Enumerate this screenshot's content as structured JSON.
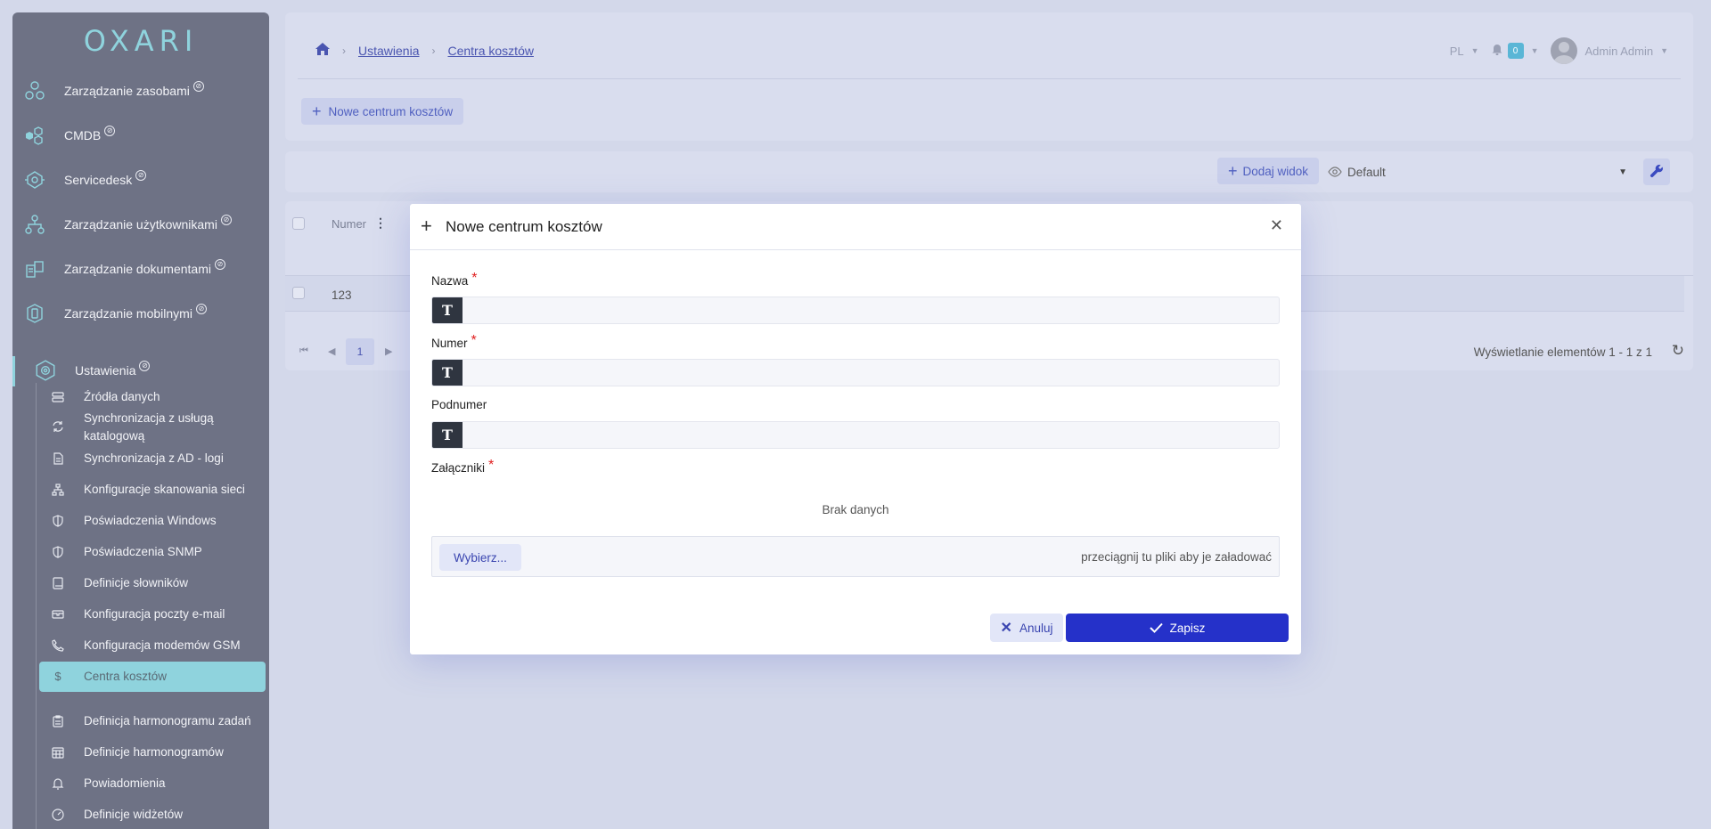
{
  "app": {
    "logo": "OXARI"
  },
  "sidebar": {
    "items": [
      {
        "label": "Zarządzanie zasobami"
      },
      {
        "label": "CMDB"
      },
      {
        "label": "Servicedesk"
      },
      {
        "label": "Zarządzanie użytkownikami"
      },
      {
        "label": "Zarządzanie dokumentami"
      },
      {
        "label": "Zarządzanie mobilnymi"
      },
      {
        "label": "Ustawienia"
      }
    ],
    "subitems": [
      {
        "label": "Źródła danych"
      },
      {
        "label": "Synchronizacja z usługą katalogową"
      },
      {
        "label": "Synchronizacja z AD - logi"
      },
      {
        "label": "Konfiguracje skanowania sieci"
      },
      {
        "label": "Poświadczenia Windows"
      },
      {
        "label": "Poświadczenia SNMP"
      },
      {
        "label": "Definicje słowników"
      },
      {
        "label": "Konfiguracja poczty e-mail"
      },
      {
        "label": "Konfiguracja modemów GSM"
      },
      {
        "label": "Centra kosztów"
      },
      {
        "label": "Definicja harmonogramu zadań"
      },
      {
        "label": "Definicje harmonogramów"
      },
      {
        "label": "Powiadomienia"
      },
      {
        "label": "Definicje widżetów"
      }
    ]
  },
  "header": {
    "breadcrumb": [
      "Ustawienia",
      "Centra kosztów"
    ],
    "new_button": "Nowe centrum kosztów",
    "language": "PL",
    "notifications": "0",
    "user": "Admin Admin"
  },
  "viewbar": {
    "add_view": "Dodaj widok",
    "view_name": "Default"
  },
  "table": {
    "column": "Numer",
    "rows": [
      {
        "numer": "123"
      }
    ],
    "page": "1",
    "info": "Wyświetlanie elementów 1 - 1 z 1"
  },
  "modal": {
    "title": "Nowe centrum kosztów",
    "fields": {
      "nazwa": {
        "label": "Nazwa",
        "value": ""
      },
      "numer": {
        "label": "Numer",
        "value": ""
      },
      "podnumer": {
        "label": "Podnumer",
        "value": ""
      }
    },
    "attachments_label": "Załączniki",
    "no_data": "Brak danych",
    "choose": "Wybierz...",
    "drop_hint": "przeciągnij tu pliki aby je załadować",
    "cancel": "Anuluj",
    "save": "Zapisz"
  }
}
